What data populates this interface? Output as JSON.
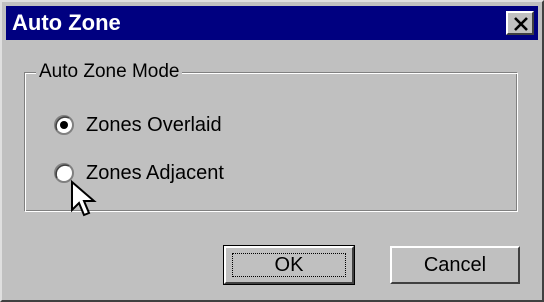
{
  "window": {
    "title": "Auto Zone"
  },
  "group": {
    "legend": "Auto Zone Mode",
    "options": [
      {
        "label": "Zones Overlaid",
        "selected": true
      },
      {
        "label": "Zones Adjacent",
        "selected": false
      }
    ]
  },
  "buttons": {
    "ok_label": "OK",
    "cancel_label": "Cancel"
  }
}
